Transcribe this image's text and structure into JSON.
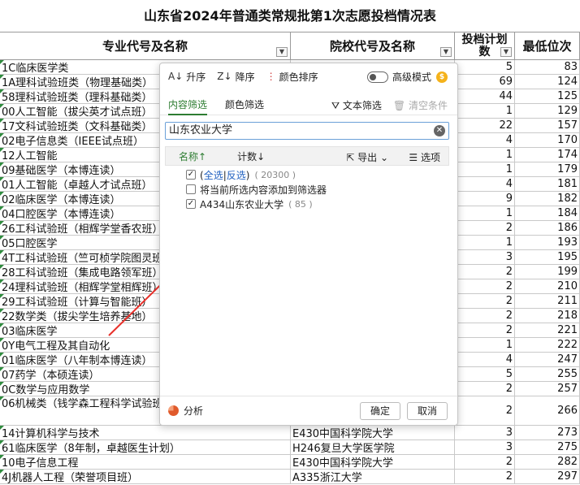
{
  "sheet": {
    "title": "山东省2024年普通类常规批第1次志愿投档情况表",
    "headers": {
      "major": "专业代号及名称",
      "school": "院校代号及名称",
      "plan_line1": "投档计划",
      "plan_line2": "数",
      "rank": "最低位次"
    },
    "rows": [
      {
        "major": "1C临床医学类",
        "school": "",
        "plan": "5",
        "rank": "83"
      },
      {
        "major": "1A理科试验班类（物理基础类）",
        "school": "",
        "plan": "69",
        "rank": "124"
      },
      {
        "major": "58理科试验班类（理科基础类）",
        "school": "",
        "plan": "44",
        "rank": "125"
      },
      {
        "major": "00人工智能（拔尖英才试点班）",
        "school": "",
        "plan": "1",
        "rank": "129"
      },
      {
        "major": "17文科试验班类（文科基础类）",
        "school": "",
        "plan": "22",
        "rank": "157"
      },
      {
        "major": "02电子信息类（IEEE试点班）",
        "school": "",
        "plan": "4",
        "rank": "170"
      },
      {
        "major": "12人工智能",
        "school": "",
        "plan": "1",
        "rank": "174"
      },
      {
        "major": "09基础医学（本博连读）",
        "school": "",
        "plan": "1",
        "rank": "179"
      },
      {
        "major": "01人工智能（卓越人才试点班）",
        "school": "",
        "plan": "4",
        "rank": "181"
      },
      {
        "major": "02临床医学（本博连读）",
        "school": "",
        "plan": "9",
        "rank": "182"
      },
      {
        "major": "04口腔医学（本博连读）",
        "school": "",
        "plan": "1",
        "rank": "184"
      },
      {
        "major": "26工科试验班（相辉学堂香农班）",
        "school": "",
        "plan": "2",
        "rank": "186"
      },
      {
        "major": "05口腔医学",
        "school": "",
        "plan": "1",
        "rank": "193"
      },
      {
        "major": "4T工科试验班（竺可桢学院图灵班）",
        "school": "",
        "plan": "3",
        "rank": "195"
      },
      {
        "major": "28工科试验班（集成电路领军班）",
        "school": "",
        "plan": "2",
        "rank": "199"
      },
      {
        "major": "24理科试验班（相辉学堂相辉班）",
        "school": "",
        "plan": "2",
        "rank": "210"
      },
      {
        "major": "29工科试验班（计算与智能班）",
        "school": "",
        "plan": "2",
        "rank": "211"
      },
      {
        "major": "22数学类（拔尖学生培养基地）",
        "school": "",
        "plan": "2",
        "rank": "218"
      },
      {
        "major": "03临床医学",
        "school": "",
        "plan": "2",
        "rank": "221"
      },
      {
        "major": "0Y电气工程及其自动化",
        "school": "",
        "plan": "1",
        "rank": "222"
      },
      {
        "major": "01临床医学（八年制本博连读）",
        "school": "",
        "plan": "4",
        "rank": "247"
      },
      {
        "major": "07药学（本硕连读）",
        "school": "",
        "plan": "5",
        "rank": "255"
      },
      {
        "major": "0C数学与应用数学",
        "school": "",
        "plan": "2",
        "rank": "257"
      },
      {
        "major": "06机械类（钱学森工程科学试验班）（本硕博贯通培养项目）",
        "school": "",
        "plan": "2",
        "rank": "266"
      },
      {
        "major": "14计算机科学与技术",
        "school": "E430中国科学院大学",
        "plan": "3",
        "rank": "273"
      },
      {
        "major": "61临床医学（8年制，卓越医生计划）",
        "school": "H246复旦大学医学院",
        "plan": "3",
        "rank": "275"
      },
      {
        "major": "10电子信息工程",
        "school": "E430中国科学院大学",
        "plan": "2",
        "rank": "282"
      },
      {
        "major": "4J机器人工程（荣誉项目班）",
        "school": "A335浙江大学",
        "plan": "2",
        "rank": "297"
      }
    ]
  },
  "filter": {
    "sort_asc": "升序",
    "sort_desc": "降序",
    "color_sort": "颜色排序",
    "advanced_mode": "高级模式",
    "coin_label": "$",
    "tab_content": "内容筛选",
    "tab_color": "颜色筛选",
    "text_filter": "文本筛选",
    "clear_conditions": "清空条件",
    "search_value": "山东农业大学",
    "col_name": "名称↑",
    "col_count": "计数↓",
    "export": "导出",
    "options": "选项",
    "select_all": "全选",
    "invert": "反选",
    "select_all_count": "( 20300 )",
    "add_current": "将当前所选内容添加到筛选器",
    "result_label": "A434山东农业大学",
    "result_count": "( 85 )",
    "analyze": "分析",
    "ok": "确定",
    "cancel": "取消"
  }
}
